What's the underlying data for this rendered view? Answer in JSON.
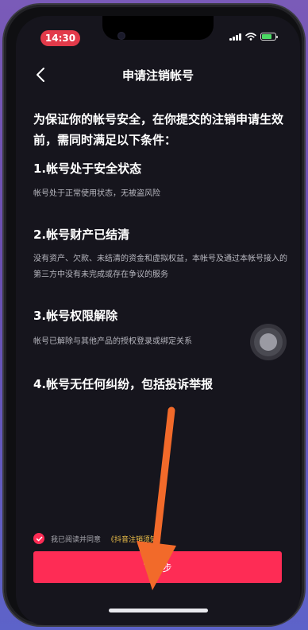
{
  "status_bar": {
    "time": "14:30"
  },
  "nav": {
    "title": "申请注销帐号"
  },
  "intro": "为保证你的帐号安全，在你提交的注销申请生效前，需同时满足以下条件：",
  "conditions": [
    {
      "title": "1.帐号处于安全状态",
      "desc": "帐号处于正常使用状态，无被盗风险"
    },
    {
      "title": "2.帐号财产已结清",
      "desc": "没有资产、欠款、未结清的资金和虚拟权益，本帐号及通过本帐号接入的第三方中没有未完成或存在争议的服务"
    },
    {
      "title": "3.帐号权限解除",
      "desc": "帐号已解除与其他产品的授权登录或绑定关系"
    },
    {
      "title": "4.帐号无任何纠纷，包括投诉举报",
      "desc": ""
    }
  ],
  "agreement": {
    "text": "我已阅读并同意",
    "link": "《抖音注销须知》"
  },
  "next_button": {
    "label": "下一步"
  },
  "colors": {
    "accent": "#fe2c55",
    "link": "#f1c34a",
    "background": "#16151d",
    "annotation_arrow": "#f26a2a"
  },
  "icons": [
    "back-arrow-icon",
    "signal-icon",
    "wifi-icon",
    "battery-icon",
    "checkmark-icon"
  ]
}
